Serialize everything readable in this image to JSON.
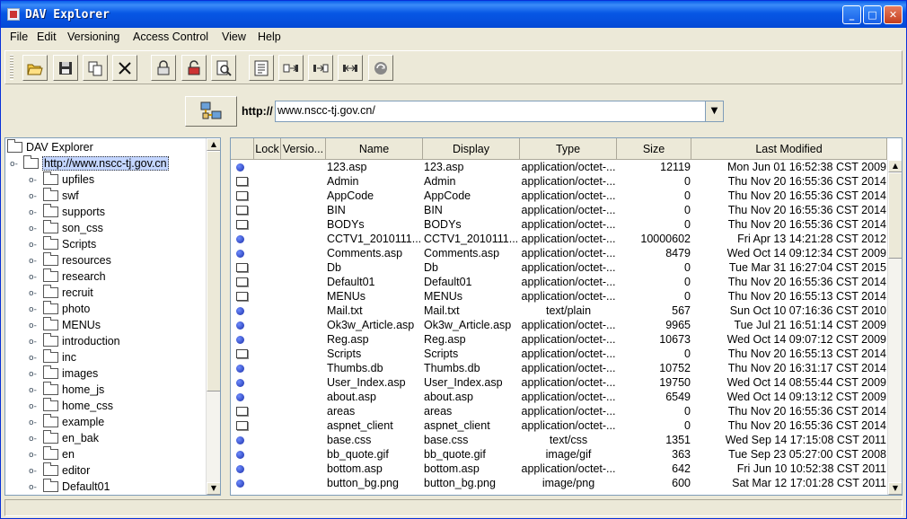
{
  "window": {
    "title": "DAV Explorer"
  },
  "menu": [
    "File",
    "Edit",
    "Versioning",
    "Access Control",
    "View",
    "Help"
  ],
  "toolbar": {
    "buttons": [
      "open-folder-icon",
      "save-icon",
      "copy-icon",
      "cut-icon",
      "lock-icon",
      "unlock-icon",
      "find-icon",
      "properties-icon",
      "put-icon",
      "get-icon",
      "move-icon",
      "refresh-icon"
    ]
  },
  "url": {
    "label": "http://",
    "value": "www.nscc-tj.gov.cn/"
  },
  "tree": {
    "root": "DAV Explorer",
    "host": "http://www.nscc-tj.gov.cn",
    "items": [
      "upfiles",
      "swf",
      "supports",
      "son_css",
      "Scripts",
      "resources",
      "research",
      "recruit",
      "photo",
      "MENUs",
      "introduction",
      "inc",
      "images",
      "home_js",
      "home_css",
      "example",
      "en_bak",
      "en",
      "editor",
      "Default01"
    ]
  },
  "table": {
    "headers": [
      "Lock",
      "Versio...",
      "Name",
      "Display",
      "Type",
      "Size",
      "Last Modified"
    ],
    "rows": [
      {
        "icon": "file",
        "name": "123.asp",
        "display": "123.asp",
        "type": "application/octet-...",
        "size": "12119",
        "modified": "Mon Jun 01 16:52:38 CST 2009"
      },
      {
        "icon": "folder",
        "name": "Admin",
        "display": "Admin",
        "type": "application/octet-...",
        "size": "0",
        "modified": "Thu Nov 20 16:55:36 CST 2014"
      },
      {
        "icon": "folder",
        "name": "AppCode",
        "display": "AppCode",
        "type": "application/octet-...",
        "size": "0",
        "modified": "Thu Nov 20 16:55:36 CST 2014"
      },
      {
        "icon": "folder",
        "name": "BIN",
        "display": "BIN",
        "type": "application/octet-...",
        "size": "0",
        "modified": "Thu Nov 20 16:55:36 CST 2014"
      },
      {
        "icon": "folder",
        "name": "BODYs",
        "display": "BODYs",
        "type": "application/octet-...",
        "size": "0",
        "modified": "Thu Nov 20 16:55:36 CST 2014"
      },
      {
        "icon": "file",
        "name": "CCTV1_2010111...",
        "display": "CCTV1_2010111...",
        "type": "application/octet-...",
        "size": "10000602",
        "modified": "Fri Apr 13 14:21:28 CST 2012"
      },
      {
        "icon": "file",
        "name": "Comments.asp",
        "display": "Comments.asp",
        "type": "application/octet-...",
        "size": "8479",
        "modified": "Wed Oct 14 09:12:34 CST 2009"
      },
      {
        "icon": "folder",
        "name": "Db",
        "display": "Db",
        "type": "application/octet-...",
        "size": "0",
        "modified": "Tue Mar 31 16:27:04 CST 2015"
      },
      {
        "icon": "folder",
        "name": "Default01",
        "display": "Default01",
        "type": "application/octet-...",
        "size": "0",
        "modified": "Thu Nov 20 16:55:36 CST 2014"
      },
      {
        "icon": "folder",
        "name": "MENUs",
        "display": "MENUs",
        "type": "application/octet-...",
        "size": "0",
        "modified": "Thu Nov 20 16:55:13 CST 2014"
      },
      {
        "icon": "file",
        "name": "Mail.txt",
        "display": "Mail.txt",
        "type": "text/plain",
        "size": "567",
        "modified": "Sun Oct 10 07:16:36 CST 2010"
      },
      {
        "icon": "file",
        "name": "Ok3w_Article.asp",
        "display": "Ok3w_Article.asp",
        "type": "application/octet-...",
        "size": "9965",
        "modified": "Tue Jul 21 16:51:14 CST 2009"
      },
      {
        "icon": "file",
        "name": "Reg.asp",
        "display": "Reg.asp",
        "type": "application/octet-...",
        "size": "10673",
        "modified": "Wed Oct 14 09:07:12 CST 2009"
      },
      {
        "icon": "folder",
        "name": "Scripts",
        "display": "Scripts",
        "type": "application/octet-...",
        "size": "0",
        "modified": "Thu Nov 20 16:55:13 CST 2014"
      },
      {
        "icon": "file",
        "name": "Thumbs.db",
        "display": "Thumbs.db",
        "type": "application/octet-...",
        "size": "10752",
        "modified": "Thu Nov 20 16:31:17 CST 2014"
      },
      {
        "icon": "file",
        "name": "User_Index.asp",
        "display": "User_Index.asp",
        "type": "application/octet-...",
        "size": "19750",
        "modified": "Wed Oct 14 08:55:44 CST 2009"
      },
      {
        "icon": "file",
        "name": "about.asp",
        "display": "about.asp",
        "type": "application/octet-...",
        "size": "6549",
        "modified": "Wed Oct 14 09:13:12 CST 2009"
      },
      {
        "icon": "folder",
        "name": "areas",
        "display": "areas",
        "type": "application/octet-...",
        "size": "0",
        "modified": "Thu Nov 20 16:55:36 CST 2014"
      },
      {
        "icon": "folder",
        "name": "aspnet_client",
        "display": "aspnet_client",
        "type": "application/octet-...",
        "size": "0",
        "modified": "Thu Nov 20 16:55:36 CST 2014"
      },
      {
        "icon": "file",
        "name": "base.css",
        "display": "base.css",
        "type": "text/css",
        "size": "1351",
        "modified": "Wed Sep 14 17:15:08 CST 2011"
      },
      {
        "icon": "file",
        "name": "bb_quote.gif",
        "display": "bb_quote.gif",
        "type": "image/gif",
        "size": "363",
        "modified": "Tue Sep 23 05:27:00 CST 2008"
      },
      {
        "icon": "file",
        "name": "bottom.asp",
        "display": "bottom.asp",
        "type": "application/octet-...",
        "size": "642",
        "modified": "Fri Jun 10 10:52:38 CST 2011"
      },
      {
        "icon": "file",
        "name": "button_bg.png",
        "display": "button_bg.png",
        "type": "image/png",
        "size": "600",
        "modified": "Sat Mar 12 17:01:28 CST 2011"
      }
    ]
  },
  "colors": {
    "titlebar": "#0554E3",
    "selection": "#C3D5FF",
    "dot": "#1B2EA8"
  }
}
